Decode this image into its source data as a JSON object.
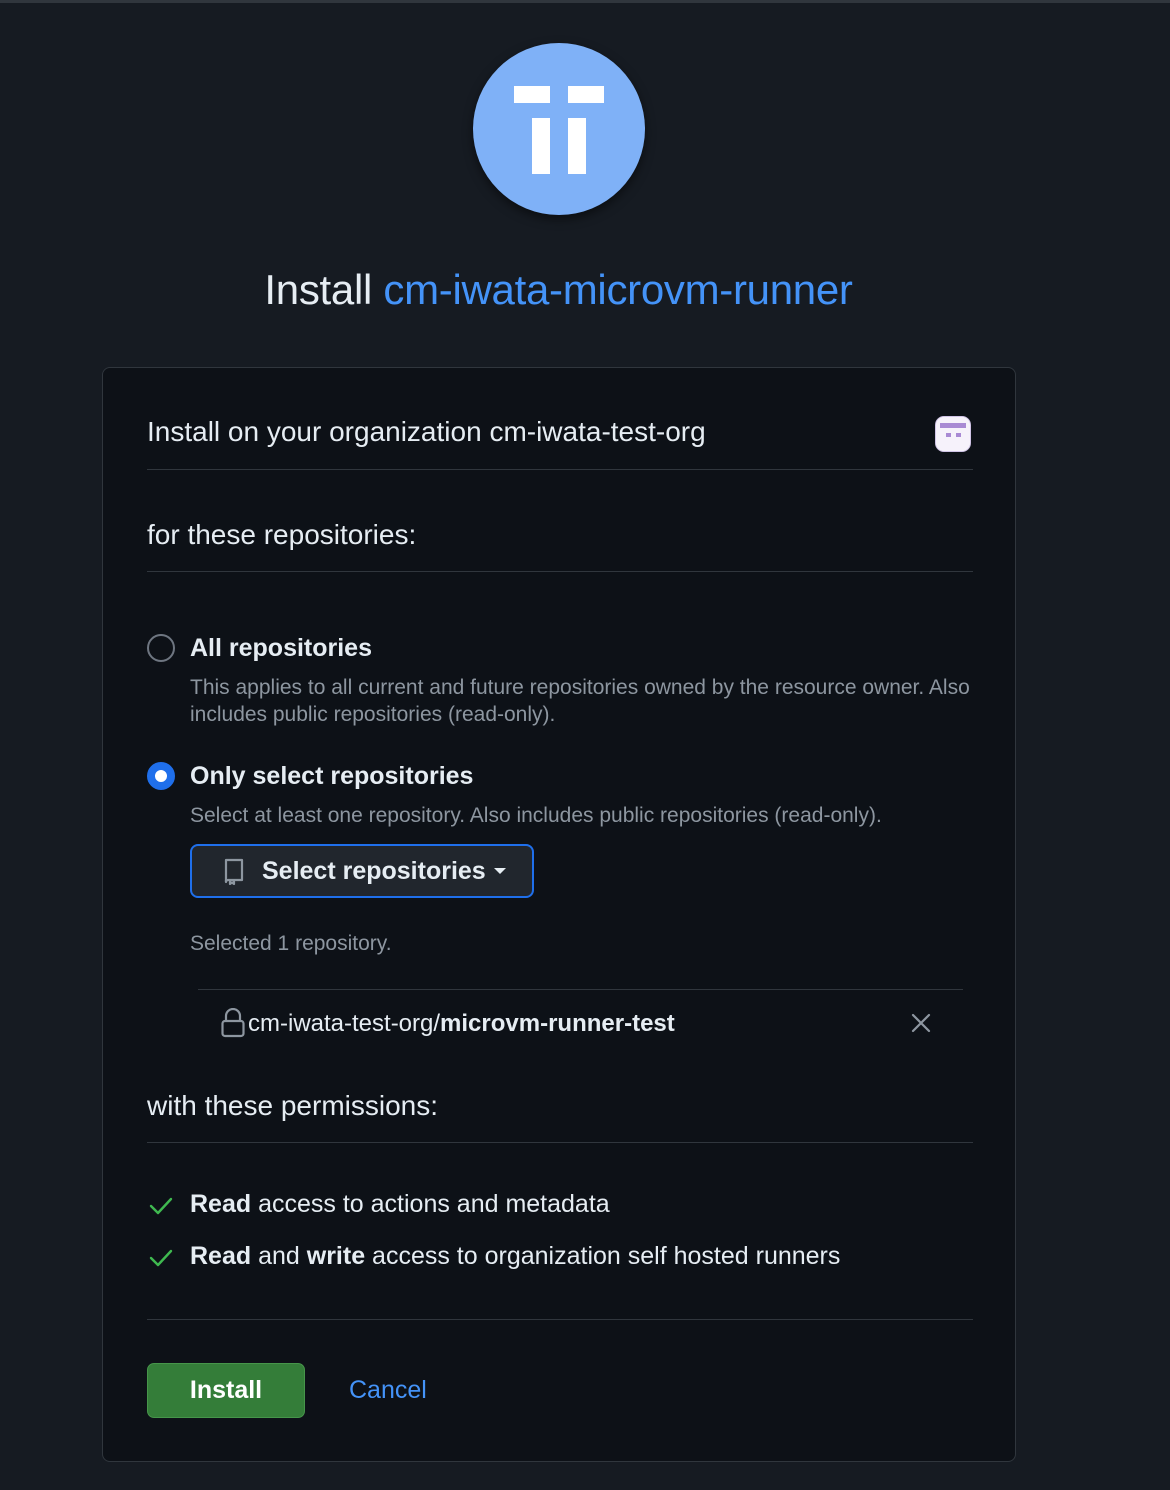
{
  "header": {
    "title_prefix": "Install",
    "app_name": "cm-iwata-microvm-runner"
  },
  "install_target": {
    "label": "Install on your organization",
    "org_name": "cm-iwata-test-org"
  },
  "repositories": {
    "heading": "for these repositories:",
    "options": [
      {
        "title": "All repositories",
        "description": "This applies to all current and future repositories owned by the resource owner. Also includes public repositories (read-only).",
        "selected": false
      },
      {
        "title": "Only select repositories",
        "description": "Select at least one repository. Also includes public repositories (read-only).",
        "selected": true
      }
    ],
    "select_button_label": "Select repositories",
    "selected_count_text": "Selected 1 repository.",
    "selected_repos": [
      {
        "owner": "cm-iwata-test-org/",
        "name": "microvm-runner-test",
        "private": true
      }
    ]
  },
  "permissions": {
    "heading": "with these permissions:",
    "items": [
      {
        "bold_1": "Read",
        "middle": "",
        "bold_2": "",
        "rest": " access to actions and metadata"
      },
      {
        "bold_1": "Read",
        "middle": " and ",
        "bold_2": "write",
        "rest": " access to organization self hosted runners"
      }
    ]
  },
  "actions": {
    "install_label": "Install",
    "cancel_label": "Cancel"
  },
  "colors": {
    "background": "#161b22",
    "card": "#0d1117",
    "accent_blue": "#4493f8",
    "logo_blue": "#7fb1f7",
    "install_green": "#347d39",
    "check_green": "#3fb950"
  },
  "icons": {
    "app_logo": "app-logo-icon",
    "org_avatar": "org-avatar-icon",
    "repo": "repo-icon",
    "lock": "lock-icon",
    "remove": "x-icon",
    "check": "check-icon",
    "caret": "caret-down-icon"
  }
}
